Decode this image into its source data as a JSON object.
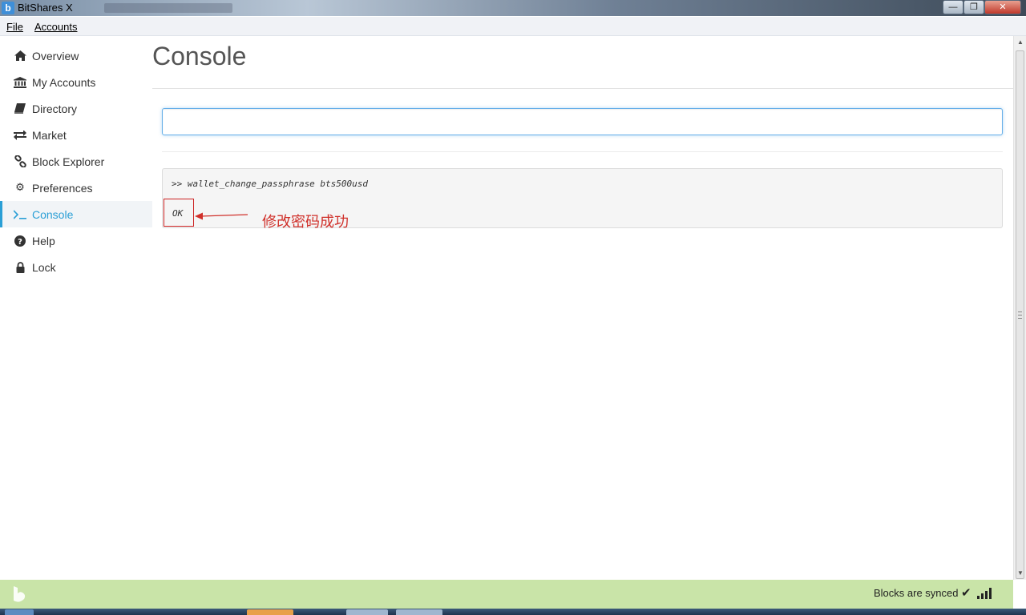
{
  "window": {
    "title": "BitShares X",
    "minimize_glyph": "—",
    "maximize_glyph": "❐",
    "close_glyph": "✕"
  },
  "menu": [
    {
      "label": "File"
    },
    {
      "label": "Accounts"
    }
  ],
  "sidebar": {
    "active": "Console",
    "items": [
      {
        "label": "Overview",
        "icon": "home-icon"
      },
      {
        "label": "My Accounts",
        "icon": "bank-icon"
      },
      {
        "label": "Directory",
        "icon": "book-icon"
      },
      {
        "label": "Market",
        "icon": "exchange-icon"
      },
      {
        "label": "Block Explorer",
        "icon": "link-icon"
      },
      {
        "label": "Preferences",
        "icon": "gears-icon"
      },
      {
        "label": "Console",
        "icon": "terminal-icon"
      },
      {
        "label": "Help",
        "icon": "question-icon"
      },
      {
        "label": "Lock",
        "icon": "lock-icon"
      }
    ]
  },
  "main": {
    "title": "Console",
    "input": {
      "value": "",
      "placeholder": ""
    },
    "output": {
      "command": ">> wallet_change_passphrase bts500usd",
      "result": "OK"
    },
    "annotation": "修改密码成功"
  },
  "statusbar": {
    "text": "Blocks are synced",
    "check_glyph": "✔"
  },
  "colors": {
    "accent": "#2a9fd6",
    "status_bg": "#c9e4a8",
    "annotation": "#d0302a"
  }
}
